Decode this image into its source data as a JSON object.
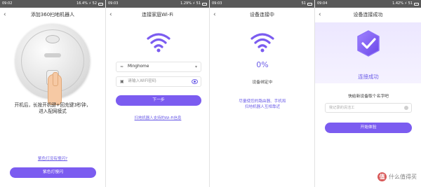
{
  "screens": [
    {
      "status": {
        "time": "09:02",
        "right": "16.4% ⚡ 52"
      },
      "title": "添加360扫地机器人",
      "instruction_line1": "开机后，长按开机键+回充键3秒钟，",
      "instruction_line2": "进入配网模式",
      "help_link": "紫色灯没有慢闪?",
      "button": "紫色灯慢闪"
    },
    {
      "status": {
        "time": "09:03",
        "right": "1.29% ⚡ 51"
      },
      "title": "连接家庭Wi-Fi",
      "ssid": "Minghome",
      "ssid_dropdown": "▾",
      "password_placeholder": "请输入WiFi密码",
      "button": "下一步",
      "link": "扫地机器人支持的Wi-Fi信息"
    },
    {
      "status": {
        "time": "09:03",
        "right": "51"
      },
      "title": "设备连接中",
      "percent": "0%",
      "status_text": "设备绑定中",
      "tip_line1": "尽量使您的路由器、手机和",
      "tip_line2": "扫地机器人互相靠近"
    },
    {
      "status": {
        "time": "09:04",
        "right": "1.42% ⚡ 51"
      },
      "title": "设备连接成功",
      "success": "连接成功",
      "prompt": "快给新设备取个名字吧",
      "name_placeholder": "我记录的清洁工",
      "button": "开始体验"
    }
  ],
  "watermark": {
    "logo_char": "值",
    "text": "什么值得买"
  },
  "colors": {
    "accent": "#7b5cf0",
    "link": "#6b5ce7",
    "statusbar": "#595959"
  },
  "icons": [
    "back-arrow-icon",
    "wifi-icon",
    "lock-icon",
    "eye-icon",
    "checkmark-icon",
    "clear-icon"
  ]
}
